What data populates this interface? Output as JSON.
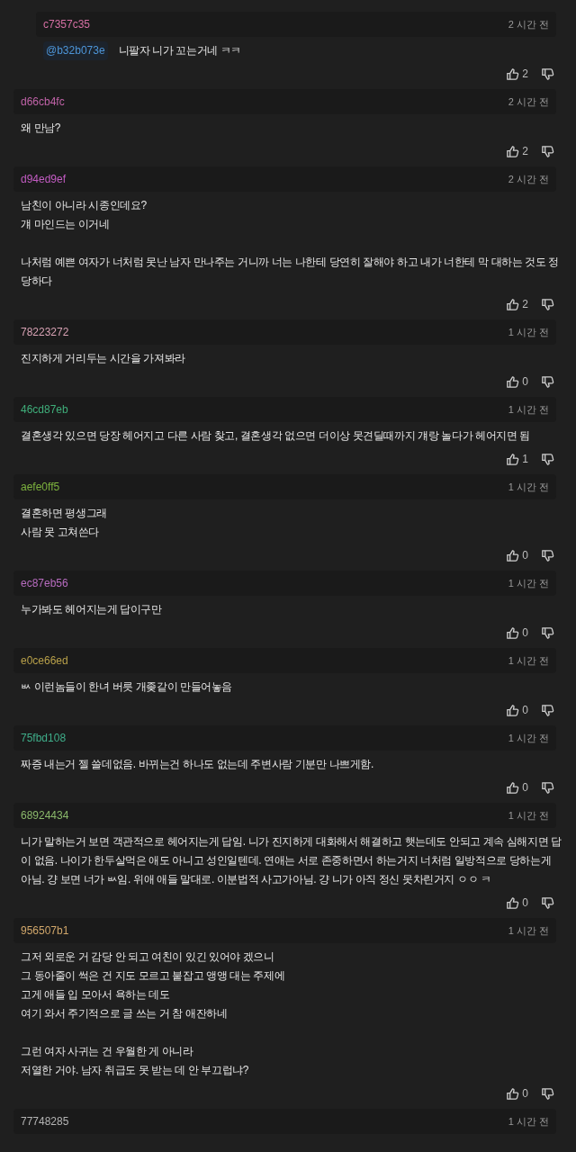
{
  "comments": [
    {
      "kind": "reply",
      "author": "c7357c35",
      "color": "#d56fa3",
      "time": "2 시간 전",
      "mention": "@b32b073e",
      "paragraphs": [
        "니팔자 니가 꼬는거네 ㅋㅋ"
      ],
      "likes": "2"
    },
    {
      "kind": "comment",
      "author": "d66cb4fc",
      "color": "#c063a8",
      "time": "2 시간 전",
      "paragraphs": [
        "왜 만남?"
      ],
      "likes": "2"
    },
    {
      "kind": "comment",
      "author": "d94ed9ef",
      "color": "#c35cc3",
      "time": "2 시간 전",
      "paragraphs": [
        "남친이 아니라 시종인데요?\n걔 마인드는 이거네",
        "나처럼 예쁜 여자가 너처럼 못난 남자 만나주는 거니까 너는 나한테 당연히 잘해야 하고 내가 너한테 막 대하는 것도 정당하다"
      ],
      "likes": "2"
    },
    {
      "kind": "comment",
      "author": "78223272",
      "color": "#d8a2b4",
      "time": "1 시간 전",
      "paragraphs": [
        "진지하게 거리두는 시간을 가져봐라"
      ],
      "likes": "0"
    },
    {
      "kind": "comment",
      "author": "46cd87eb",
      "color": "#3fae7a",
      "time": "1 시간 전",
      "paragraphs": [
        "결혼생각 있으면 당장 헤어지고 다른 사람 찾고, 결혼생각 없으면 더이상 못견딜때까지 걔랑 놀다가 헤어지면 됨"
      ],
      "likes": "1"
    },
    {
      "kind": "comment",
      "author": "aefe0ff5",
      "color": "#7db33e",
      "time": "1 시간 전",
      "paragraphs": [
        "결혼하면 평생그래\n사람 못 고쳐쓴다"
      ],
      "likes": "0"
    },
    {
      "kind": "comment",
      "author": "ec87eb56",
      "color": "#b86cc0",
      "time": "1 시간 전",
      "paragraphs": [
        "누가봐도 헤어지는게 답이구만"
      ],
      "likes": "0"
    },
    {
      "kind": "comment",
      "author": "e0ce66ed",
      "color": "#b8a04a",
      "time": "1 시간 전",
      "paragraphs": [
        "ㅄ 이런놈들이 한녀 버릇 개좆같이 만들어놓음"
      ],
      "likes": "0"
    },
    {
      "kind": "comment",
      "author": "75fbd108",
      "color": "#3fae8a",
      "time": "1 시간 전",
      "paragraphs": [
        "짜증 내는거 젤 쓸데없음. 바뀌는건 하나도 없는데 주변사람 기분만 나쁘게함."
      ],
      "likes": "0"
    },
    {
      "kind": "comment",
      "author": "68924434",
      "color": "#8ab86a",
      "time": "1 시간 전",
      "paragraphs": [
        "니가 말하는거 보면 객관적으로 헤어지는게 답임. 니가 진지하게 대화해서 해결하고 햇는데도 안되고 계속 심해지면 답이 없음. 나이가 한두살먹은 애도 아니고 성인일텐데. 연애는 서로 존중하면서 하는거지 너처럼 일방적으로 당하는게 아님. 걍 보면 너가 ㅄ임. 위애 애들 말대로. 이분법적 사고가아님. 걍 니가 아직 정신 못차린거지 ㅇㅇ ㅋ"
      ],
      "likes": "0"
    },
    {
      "kind": "comment",
      "author": "956507b1",
      "color": "#d0a66a",
      "time": "1 시간 전",
      "paragraphs": [
        "그저 외로운 거 감당 안 되고 여친이 있긴 있어야 겠으니\n그 동아줄이 썩은 건 지도 모르고 붙잡고 앵앵 대는 주제에\n고게 애들 입 모아서 욕하는 데도\n여기 와서 주기적으로 글 쓰는 거 참 애잔하네",
        "그런 여자 사귀는 건 우월한 게 아니라\n저열한 거야. 남자 취급도 못 받는 데 안 부끄럽냐?"
      ],
      "likes": "0"
    },
    {
      "kind": "comment",
      "author": "77748285",
      "color": "#b4b4b4",
      "time": "1 시간 전"
    }
  ]
}
